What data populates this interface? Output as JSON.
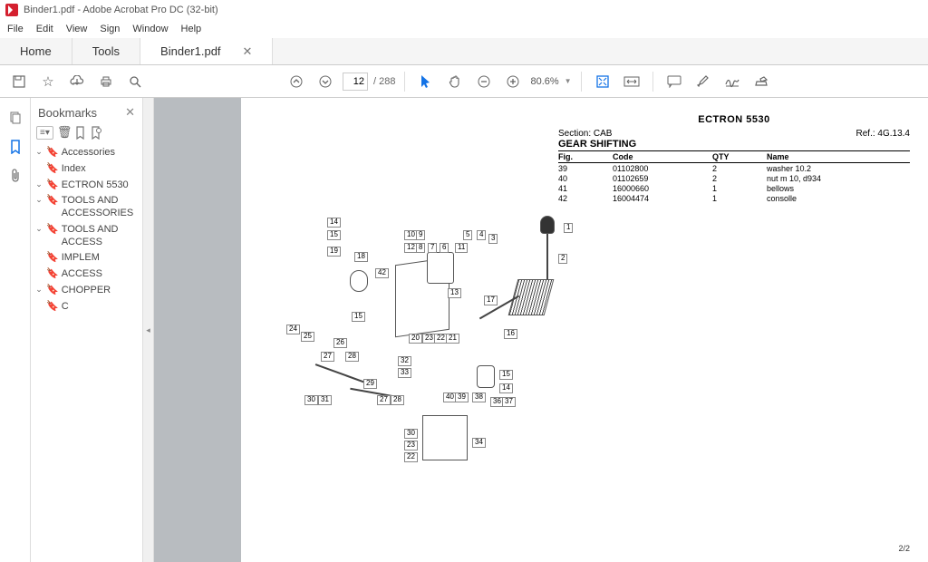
{
  "window": {
    "title": "Binder1.pdf - Adobe Acrobat Pro DC (32-bit)"
  },
  "menu": {
    "items": [
      "File",
      "Edit",
      "View",
      "Sign",
      "Window",
      "Help"
    ]
  },
  "tabs": {
    "home": "Home",
    "tools": "Tools",
    "file": "Binder1.pdf"
  },
  "toolbar": {
    "page_current": "12",
    "page_total": "/ 288",
    "zoom": "80.6%"
  },
  "bookmarks": {
    "title": "Bookmarks",
    "items": {
      "accessories": "Accessories",
      "index": "Index",
      "ectron": "ECTRON 5530",
      "tools_acc_l2": "TOOLS AND ACCESSORIES",
      "tools_acc_l3": "TOOLS AND ACCESS",
      "implem": "IMPLEM",
      "access": "ACCESS",
      "chopper": "CHOPPER",
      "c": "C"
    }
  },
  "doc": {
    "title": "ECTRON 5530",
    "section_label": "Section: CAB",
    "subtitle": "GEAR SHIFTING",
    "ref": "Ref.: 4G.13.4",
    "headers": {
      "fig": "Fig.",
      "code": "Code",
      "qty": "QTY",
      "name": "Name"
    },
    "rows": [
      {
        "fig": "39",
        "code": "01102800",
        "qty": "2",
        "name": "washer 10.2"
      },
      {
        "fig": "40",
        "code": "01102659",
        "qty": "2",
        "name": "nut m 10, d934"
      },
      {
        "fig": "41",
        "code": "16000660",
        "qty": "1",
        "name": "bellows"
      },
      {
        "fig": "42",
        "code": "16004474",
        "qty": "1",
        "name": "consolle"
      }
    ],
    "callouts": [
      "14",
      "15",
      "19",
      "18",
      "10",
      "9",
      "12",
      "8",
      "7",
      "6",
      "11",
      "5",
      "4",
      "3",
      "2",
      "1",
      "42",
      "13",
      "17",
      "16",
      "24",
      "25",
      "27",
      "26",
      "28",
      "30",
      "31",
      "29",
      "32",
      "33",
      "20",
      "23",
      "22",
      "21",
      "40",
      "39",
      "38",
      "36",
      "37",
      "34"
    ],
    "page_num": "2/2"
  }
}
